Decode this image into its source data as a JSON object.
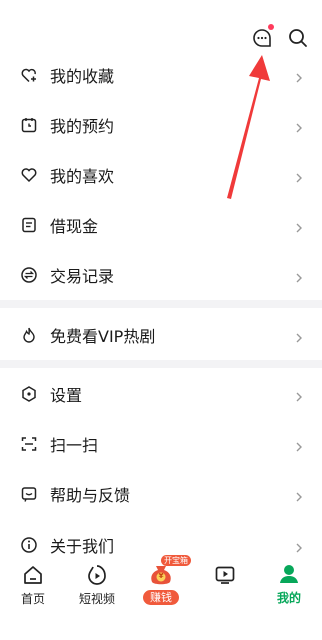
{
  "menu_group1": [
    {
      "label": "我的收藏",
      "icon": "heart-plus-icon"
    },
    {
      "label": "我的预约",
      "icon": "calendar-icon"
    },
    {
      "label": "我的喜欢",
      "icon": "heart-icon"
    },
    {
      "label": "借现金",
      "icon": "document-icon"
    },
    {
      "label": "交易记录",
      "icon": "exchange-icon"
    }
  ],
  "menu_group2": [
    {
      "label": "免费看VIP热剧",
      "icon": "flame-icon"
    }
  ],
  "menu_group3": [
    {
      "label": "设置",
      "icon": "hexagon-settings-icon"
    },
    {
      "label": "扫一扫",
      "icon": "scan-icon"
    },
    {
      "label": "帮助与反馈",
      "icon": "feedback-icon"
    },
    {
      "label": "关于我们",
      "icon": "info-icon"
    }
  ],
  "tabbar": {
    "home": "首页",
    "short_video": "短视频",
    "earn": "赚钱",
    "earn_badge": "开宝箱",
    "earn_coin": "¥",
    "tv_label": "",
    "me": "我的"
  },
  "colors": {
    "accent_green": "#07a75a",
    "arrow_red": "#f03a3a",
    "badge_red": "#ff3b5c"
  }
}
